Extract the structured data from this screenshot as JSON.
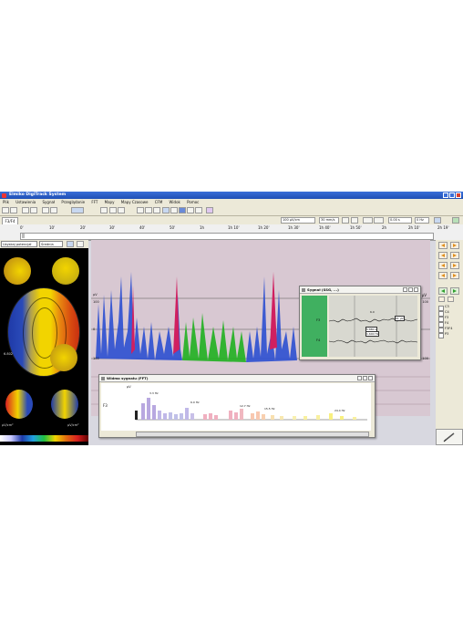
{
  "title": "Elmiko DigiTrack System",
  "menu": [
    "Plik",
    "Ustawienia",
    "Sygnał",
    "Przeglądanie",
    "FFT",
    "Mapy",
    "Mapy Czasowe",
    "CFM",
    "Widok",
    "Pomoc"
  ],
  "toolbar": {
    "amplitude_value": "100 µV/cm",
    "speed_value": "30 mm/s",
    "offset_value": "0.00 s",
    "filter_value": "0 Hz"
  },
  "tab": {
    "label": "F3/F4"
  },
  "ruler": {
    "time_ticks": [
      "0'",
      "10'",
      "20'",
      "30'",
      "40'",
      "50'",
      "1h",
      "1h 10'",
      "1h 20'",
      "1h 30'",
      "1h 40'",
      "1h 50'",
      "2h",
      "2h 10'",
      "2h 19'"
    ]
  },
  "left_panel": {
    "mode_select": "Uzyskaj potencjał",
    "average_select": "Średnia",
    "scale_label_left": "µV/cm²",
    "scale_label_right": "µV/cm²",
    "small_value": "6.802",
    "colors": {
      "pos": "#f2d400",
      "neg": "#1f3aa8",
      "mid": "#e06a10",
      "red": "#d82020"
    }
  },
  "main_plot": {
    "axis_label_top": "µV",
    "tick_a": "100",
    "tick_b": "0",
    "tick_c": "100",
    "tick_right_top": "µV",
    "tick_right_a": "100",
    "tick_right_b": "100",
    "series_colors": {
      "blue": "#2c4fd0",
      "green": "#20b020",
      "red": "#d02060"
    }
  },
  "signal_window": {
    "title": "Sygnał (SSG, ...)",
    "channel_1": "F3",
    "channel_2": "F4",
    "marker_a": "5.880 s",
    "marker_b": "1.600 Hz",
    "marker_c": "61 µV",
    "cursor_label": "6.0"
  },
  "spectrum_window": {
    "title": "Widmo sygnału (FFT)",
    "y_unit": "µV",
    "channel": "F3",
    "labels": [
      "3.3 Hz",
      "6.0 Hz",
      "12.7 Hz",
      "15.5 Hz",
      "24.4 Hz"
    ]
  },
  "right_panel": {
    "checkbox_labels": [
      "C3",
      "C4",
      "F3",
      "F4",
      "F3F4",
      "P3"
    ]
  }
}
